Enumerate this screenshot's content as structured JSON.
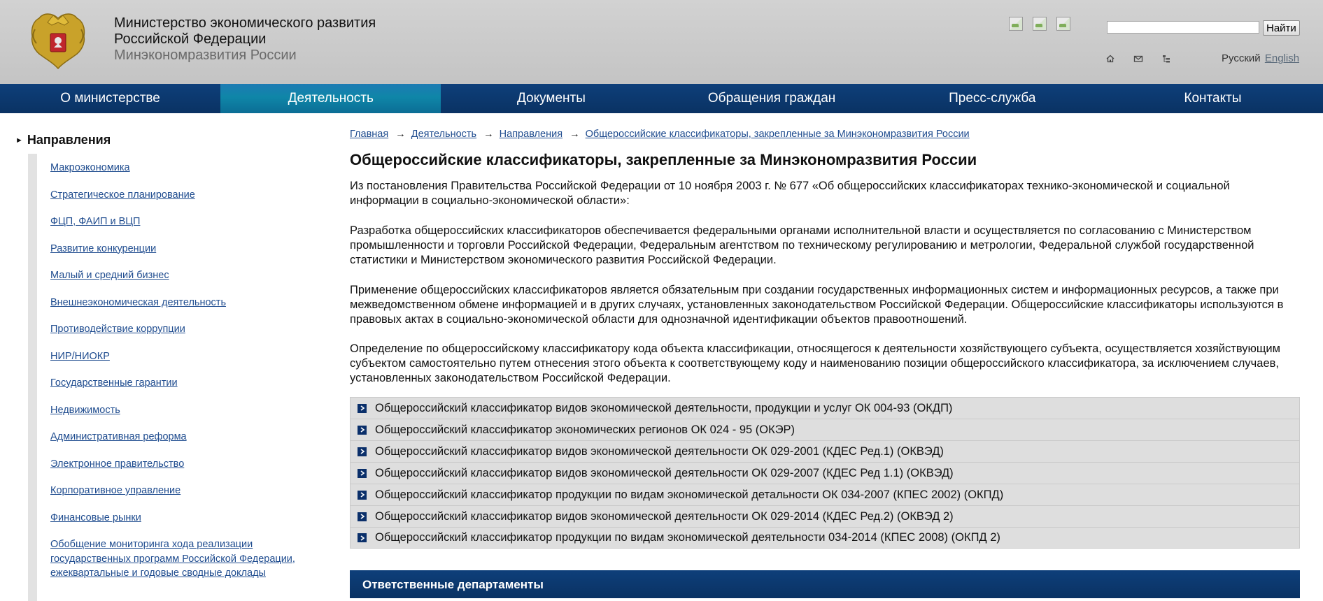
{
  "header": {
    "org_line1": "Министерство экономического развития",
    "org_line2": "Российской Федерации",
    "org_line3": "Минэкономразвития России",
    "search": {
      "placeholder": "",
      "button_label": "Найти"
    },
    "utility_icons": [
      "home-icon",
      "mail-icon",
      "sitemap-icon"
    ],
    "lang": {
      "ru": "Русский",
      "en": "English"
    }
  },
  "nav": {
    "items": [
      "О министерстве",
      "Деятельность",
      "Документы",
      "Обращения граждан",
      "Пресс-служба",
      "Контакты"
    ],
    "active": "Деятельность"
  },
  "sidebar": {
    "heading": "Направления",
    "items": [
      "Макроэкономика",
      "Стратегическое планирование",
      "ФЦП, ФАИП и ВЦП",
      "Развитие конкуренции",
      "Малый и средний бизнес",
      "Внешнеэкономическая деятельность",
      "Противодействие коррупции",
      "НИР/НИОКР",
      "Государственные гарантии",
      "Недвижимость",
      "Административная реформа",
      "Электронное правительство",
      "Корпоративное управление",
      "Финансовые рынки",
      "Обобщение мониторинга хода реализации государственных программ Российской Федерации, ежеквартальные и годовые сводные доклады"
    ]
  },
  "breadcrumb": {
    "items": [
      "Главная",
      "Деятельность",
      "Направления",
      "Общероссийские классификаторы, закрепленные за Минэкономразвития России"
    ],
    "separator": "→"
  },
  "page": {
    "title": "Общероссийские классификаторы, закрепленные за Минэкономразвития России",
    "paragraphs": [
      "Из постановления Правительства Российской Федерации от 10 ноября 2003 г. № 677 «Об общероссийских классификаторах технико-экономической и социальной информации в социально-экономической области»:",
      "Разработка общероссийских классификаторов обеспечивается федеральными органами исполнительной власти и осуществляется по согласованию с Министерством промышленности и торговли Российской Федерации, Федеральным агентством по техническому регулированию и метрологии, Федеральной службой государственной статистики и Министерством экономического развития Российской Федерации.",
      "Применение общероссийских классификаторов является обязательным при создании государственных информационных систем и информационных ресурсов, а также при межведомственном обмене информацией и в других случаях, установленных законодательством Российской Федерации. Общероссийские классификаторы используются в правовых актах в социально-экономической области для однозначной идентификации объектов правоотношений.",
      "Определение по общероссийскому классификатору кода объекта классификации, относящегося к деятельности хозяйствующего субъекта, осуществляется хозяйствующим субъектом самостоятельно путем отнесения этого объекта к соответствующему коду и наименованию позиции общероссийского классификатора, за исключением случаев, установленных законодательством Российской Федерации."
    ],
    "classifiers": [
      "Общероссийский классификатор видов экономической деятельности, продукции и услуг ОК 004-93 (ОКДП)",
      "Общероссийский классификатор экономических регионов ОК 024 - 95 (ОКЭР)",
      "Общероссийский классификатор видов экономической деятельности ОК 029-2001 (КДЕС Ред.1) (ОКВЭД)",
      "Общероссийский классификатор видов экономической деятельности ОК 029-2007 (КДЕС Ред 1.1) (ОКВЭД)",
      "Общероссийский классификатор продукции по видам экономической детальности ОК 034-2007 (КПЕС 2002) (ОКПД)",
      "Общероссийский классификатор видов экономической деятельности ОК 029-2014 (КДЕС Ред.2) (ОКВЭД 2)",
      "Общероссийский классификатор продукции по видам экономической деятельности 034-2014 (КПЕС 2008) (ОКПД 2)"
    ],
    "departments_heading": "Ответственные департаменты"
  },
  "colors": {
    "nav_bg": "#0a3263",
    "nav_active": "#0f86a8",
    "link": "#1f4c8f",
    "row_bg": "#dedede",
    "header_bg": "#cbcbcb"
  }
}
